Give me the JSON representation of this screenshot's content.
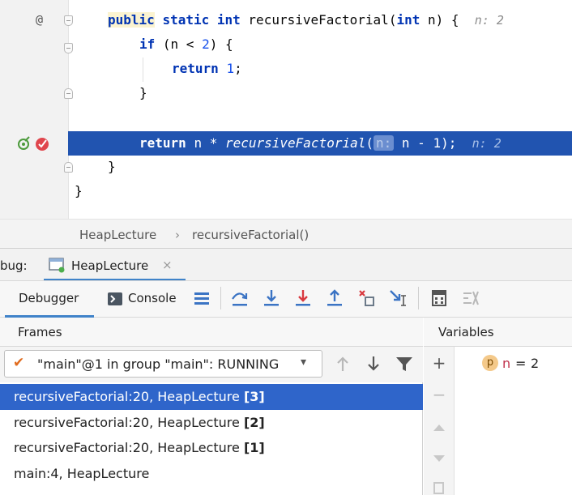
{
  "editor": {
    "gutter": {
      "annotation": "@"
    },
    "lines": {
      "sig_kw1": "public",
      "sig_kw2": "static",
      "sig_kw3": "int",
      "sig_name": "recursiveFactorial(",
      "sig_kw4": "int",
      "sig_rest": "n) {",
      "sig_hint": "n: 2",
      "if_kw": "if",
      "if_open": "(n < ",
      "if_num": "2",
      "if_close": ") {",
      "ret1_kw": "return",
      "ret1_num": "1",
      "ret1_end": ";",
      "brace_inner": "}",
      "exec_kw": "return",
      "exec_mid": "n * ",
      "exec_call": "recursiveFactorial",
      "exec_paren": "(",
      "exec_param_hint": "n:",
      "exec_arg": "n - 1);",
      "exec_hint": "n: 2",
      "brace_method": "}",
      "brace_class": "}"
    }
  },
  "breadcrumb": {
    "items": [
      "HeapLecture",
      "recursiveFactorial()"
    ],
    "separator": "›"
  },
  "debug": {
    "title": "bug:",
    "session_label": "HeapLecture",
    "close": "×"
  },
  "toolbar": {
    "tab_debugger": "Debugger",
    "tab_console": "Console"
  },
  "frames": {
    "title": "Frames",
    "thread": "\"main\"@1 in group \"main\": RUNNING",
    "rows": [
      {
        "text": "recursiveFactorial:20, HeapLecture ",
        "index": "[3]"
      },
      {
        "text": "recursiveFactorial:20, HeapLecture ",
        "index": "[2]"
      },
      {
        "text": "recursiveFactorial:20, HeapLecture ",
        "index": "[1]"
      },
      {
        "text": "main:4, HeapLecture",
        "index": ""
      }
    ]
  },
  "variables": {
    "title": "Variables",
    "items": [
      {
        "badge": "p",
        "name": "n",
        "eq": "=",
        "value": "2"
      }
    ]
  },
  "colors": {
    "accent": "#4083c9",
    "exec_line": "#2154b0",
    "selected_frame": "#2f65ca",
    "keyword": "#0033b3"
  }
}
